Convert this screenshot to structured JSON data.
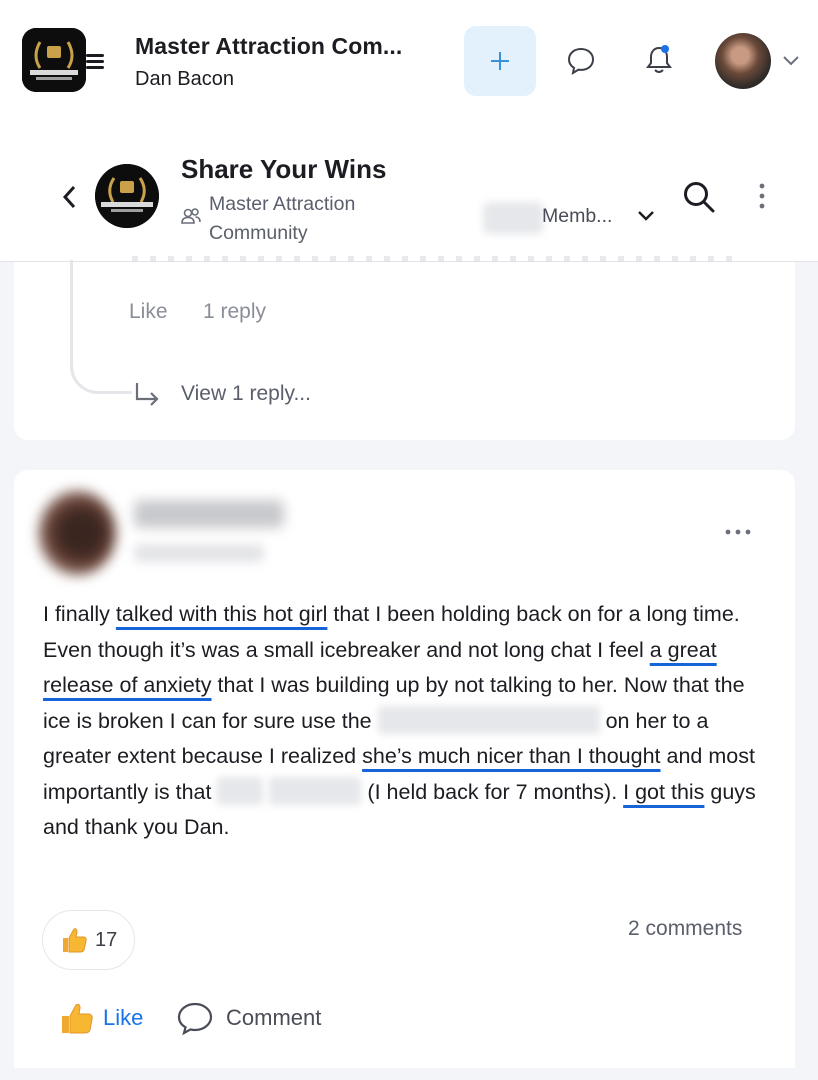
{
  "app": {
    "title": "Master Attraction Com...",
    "user_name": "Dan Bacon",
    "logo_text": "MASTER ATTRACTION COMMUNITY"
  },
  "group": {
    "title": "Share Your Wins",
    "community": "Master Attraction Community",
    "members_label": "Memb...",
    "logo_text": "MASTER ATTRACTION COMMUNITY"
  },
  "previous_comment": {
    "like_label": "Like",
    "reply_count": "1 reply",
    "view_replies": "View 1 reply..."
  },
  "post": {
    "text_segments": [
      "I finally ",
      "talked with this hot girl",
      " that I been holding back on for a long time. Even though it’s was a small icebreaker and not long chat I feel ",
      "a great release of anxiety",
      " that I was building up by not talking to her. Now that the ice is broken I can for sure use the ",
      " on her to a greater extent because I realized ",
      "she’s much nicer than I thought",
      " and most importantly is that ",
      " (I held back for 7 months). ",
      "I got this",
      " guys and thank you Dan."
    ],
    "reaction_count": "17",
    "comments_count": "2 comments",
    "like_label": "Like",
    "comment_label": "Comment"
  },
  "colors": {
    "accent": "#1a73e8",
    "underline": "#1565d8",
    "plus_bg": "#e3f1fd",
    "background": "#f4f5f8"
  },
  "icons": [
    "hamburger-icon",
    "plus-icon",
    "chat-bubble-icon",
    "bell-icon",
    "chevron-down-icon",
    "back-arrow-icon",
    "members-icon",
    "search-icon",
    "more-vertical-icon",
    "reply-arrow-icon",
    "more-horizontal-icon",
    "thumbs-up-icon",
    "comment-icon"
  ]
}
